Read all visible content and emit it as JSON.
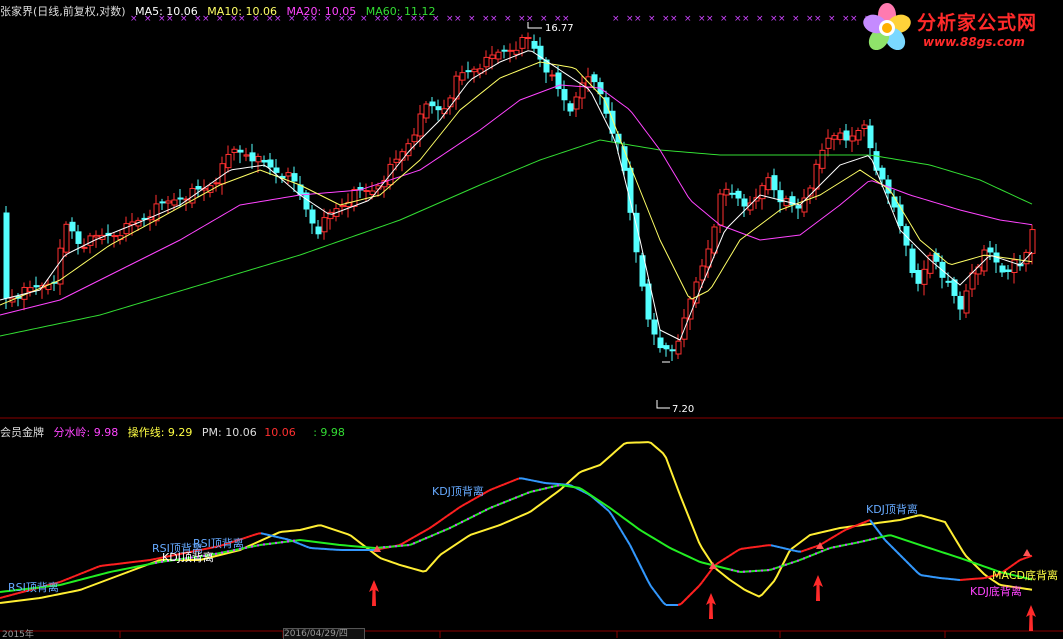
{
  "top_header": {
    "stock_label": "张家界(日线,前复权,对数)",
    "ma5": "MA5: 10.06",
    "ma10": "MA10: 10.06",
    "ma20": "MA20: 10.05",
    "ma60": "MA60: 11.12"
  },
  "bottom_header": {
    "name": "会员金牌",
    "fenshuiling": "分水岭: 9.98",
    "caozuoxian": "操作线: 9.29",
    "pm": "PM: 10.06",
    "v1": "10.06",
    "v2": ": 9.98"
  },
  "logo": {
    "title": "分析家公式网",
    "url": "www.88gs.com"
  },
  "price_markers": {
    "high": "16.77",
    "low": "7.20"
  },
  "date_label": "2016/04/29/四",
  "axis_fragments": [
    "2015年"
  ],
  "signals": {
    "rsi_top": "RSI顶背离",
    "kdj_top": "KDJ顶背离",
    "kdj_bottom": "KDJ底背离",
    "macd_bottom": "MACD底背离"
  },
  "colors": {
    "up": "#ff3030",
    "down": "#54ffff",
    "ma5": "#ffffff",
    "ma10": "#ffff66",
    "ma20": "#ff44ff",
    "ma60": "#33dd33",
    "grid": "#8a0000"
  },
  "chart_data": [
    {
      "type": "candlestick",
      "title": "张家界(日线,前复权,对数)",
      "high_marker": 16.77,
      "low_marker": 7.2
    },
    {
      "type": "line",
      "title": "会员金牌",
      "series": [
        {
          "name": "分水岭",
          "value": 9.98
        },
        {
          "name": "操作线",
          "value": 9.29
        },
        {
          "name": "PM",
          "value": 10.06
        }
      ]
    }
  ]
}
